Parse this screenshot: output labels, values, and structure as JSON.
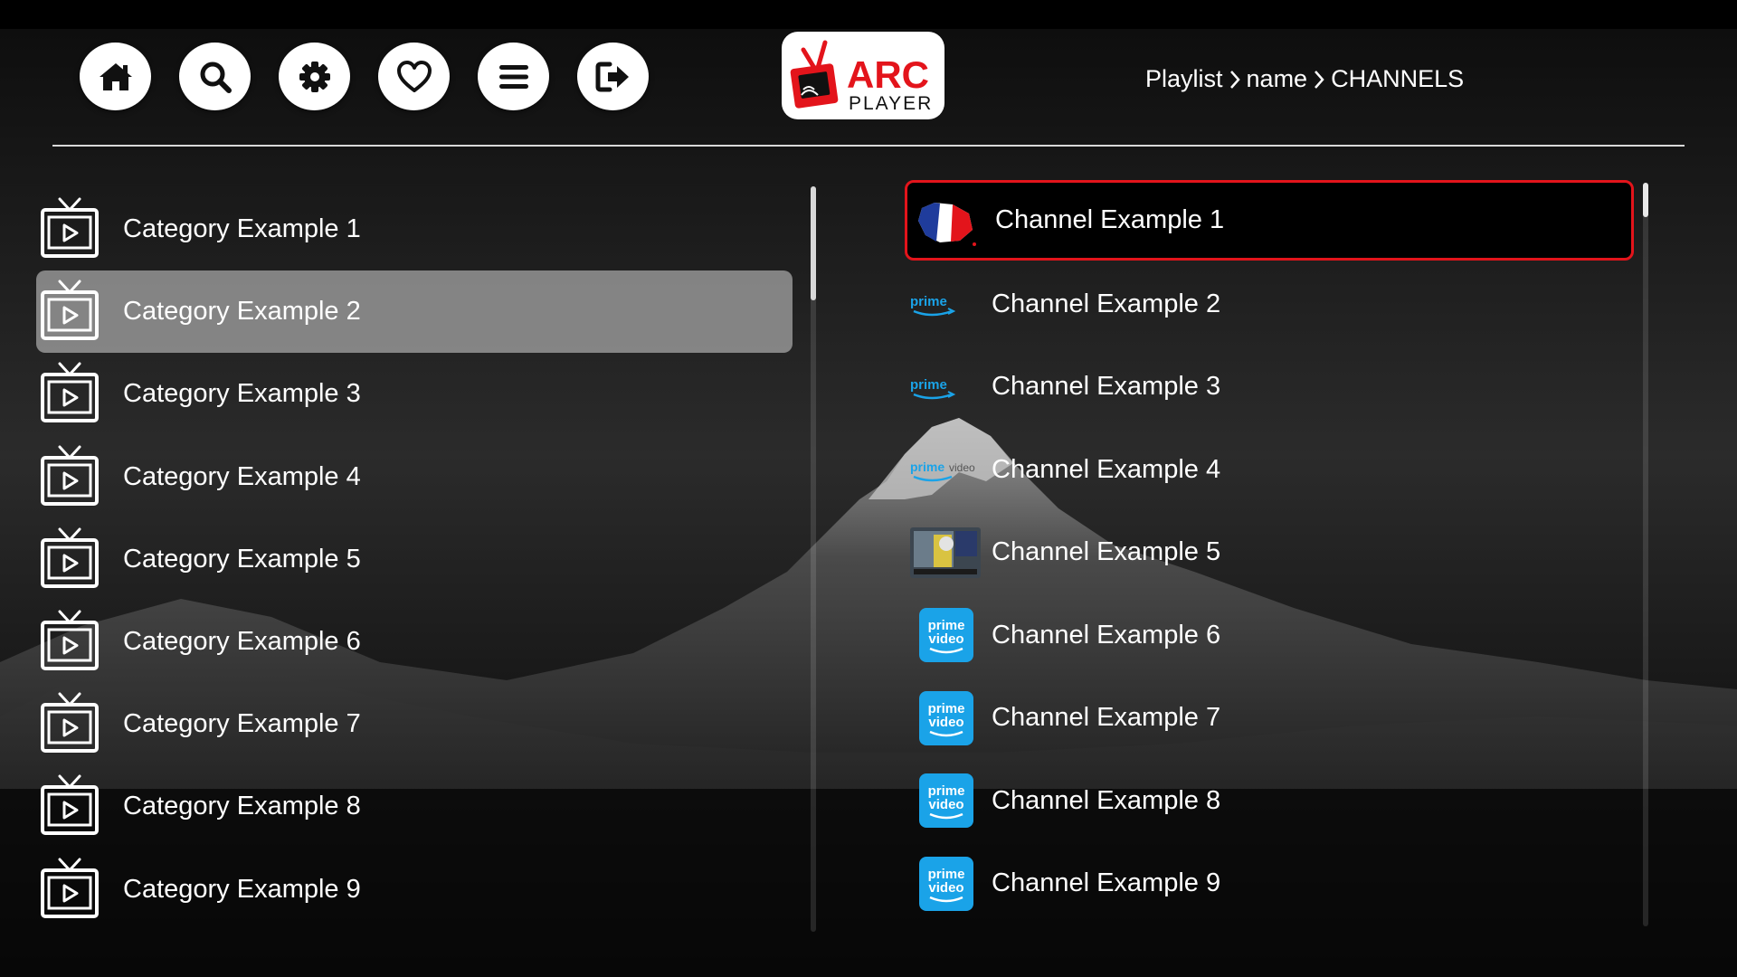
{
  "app": {
    "logo_top": "ARC",
    "logo_bottom": "PLAYER",
    "accent_color": "#e3141b"
  },
  "toolbar": {
    "buttons": [
      {
        "name": "home-icon"
      },
      {
        "name": "search-icon"
      },
      {
        "name": "gear-icon"
      },
      {
        "name": "heart-icon"
      },
      {
        "name": "menu-icon"
      },
      {
        "name": "logout-icon"
      }
    ]
  },
  "breadcrumb": {
    "part1": "Playlist",
    "part2": "name",
    "part3": "CHANNELS"
  },
  "categories": {
    "selected_index": 1,
    "items": [
      {
        "label": "Category Example 1"
      },
      {
        "label": "Category Example 2"
      },
      {
        "label": "Category Example 3"
      },
      {
        "label": "Category Example 4"
      },
      {
        "label": "Category Example 5"
      },
      {
        "label": "Category Example 6"
      },
      {
        "label": "Category Example 7"
      },
      {
        "label": "Category Example 8"
      },
      {
        "label": "Category Example 9"
      }
    ]
  },
  "channels": {
    "selected_index": 0,
    "items": [
      {
        "label": "Channel Example 1",
        "logo": "france-flag-logo"
      },
      {
        "label": "Channel Example 2",
        "logo": "prime-logo"
      },
      {
        "label": "Channel Example 3",
        "logo": "prime-logo"
      },
      {
        "label": "Channel Example 4",
        "logo": "prime-video-text-logo",
        "logo_text_a": "prime",
        "logo_text_b": "video"
      },
      {
        "label": "Channel Example 5",
        "logo": "sports-thumbnail-logo"
      },
      {
        "label": "Channel Example 6",
        "logo": "prime-video-tile-logo",
        "logo_text_a": "prime",
        "logo_text_b": "video"
      },
      {
        "label": "Channel Example 7",
        "logo": "prime-video-tile-logo",
        "logo_text_a": "prime",
        "logo_text_b": "video"
      },
      {
        "label": "Channel Example 8",
        "logo": "prime-video-tile-logo",
        "logo_text_a": "prime",
        "logo_text_b": "video"
      },
      {
        "label": "Channel Example 9",
        "logo": "prime-video-tile-logo",
        "logo_text_a": "prime",
        "logo_text_b": "video"
      }
    ]
  }
}
